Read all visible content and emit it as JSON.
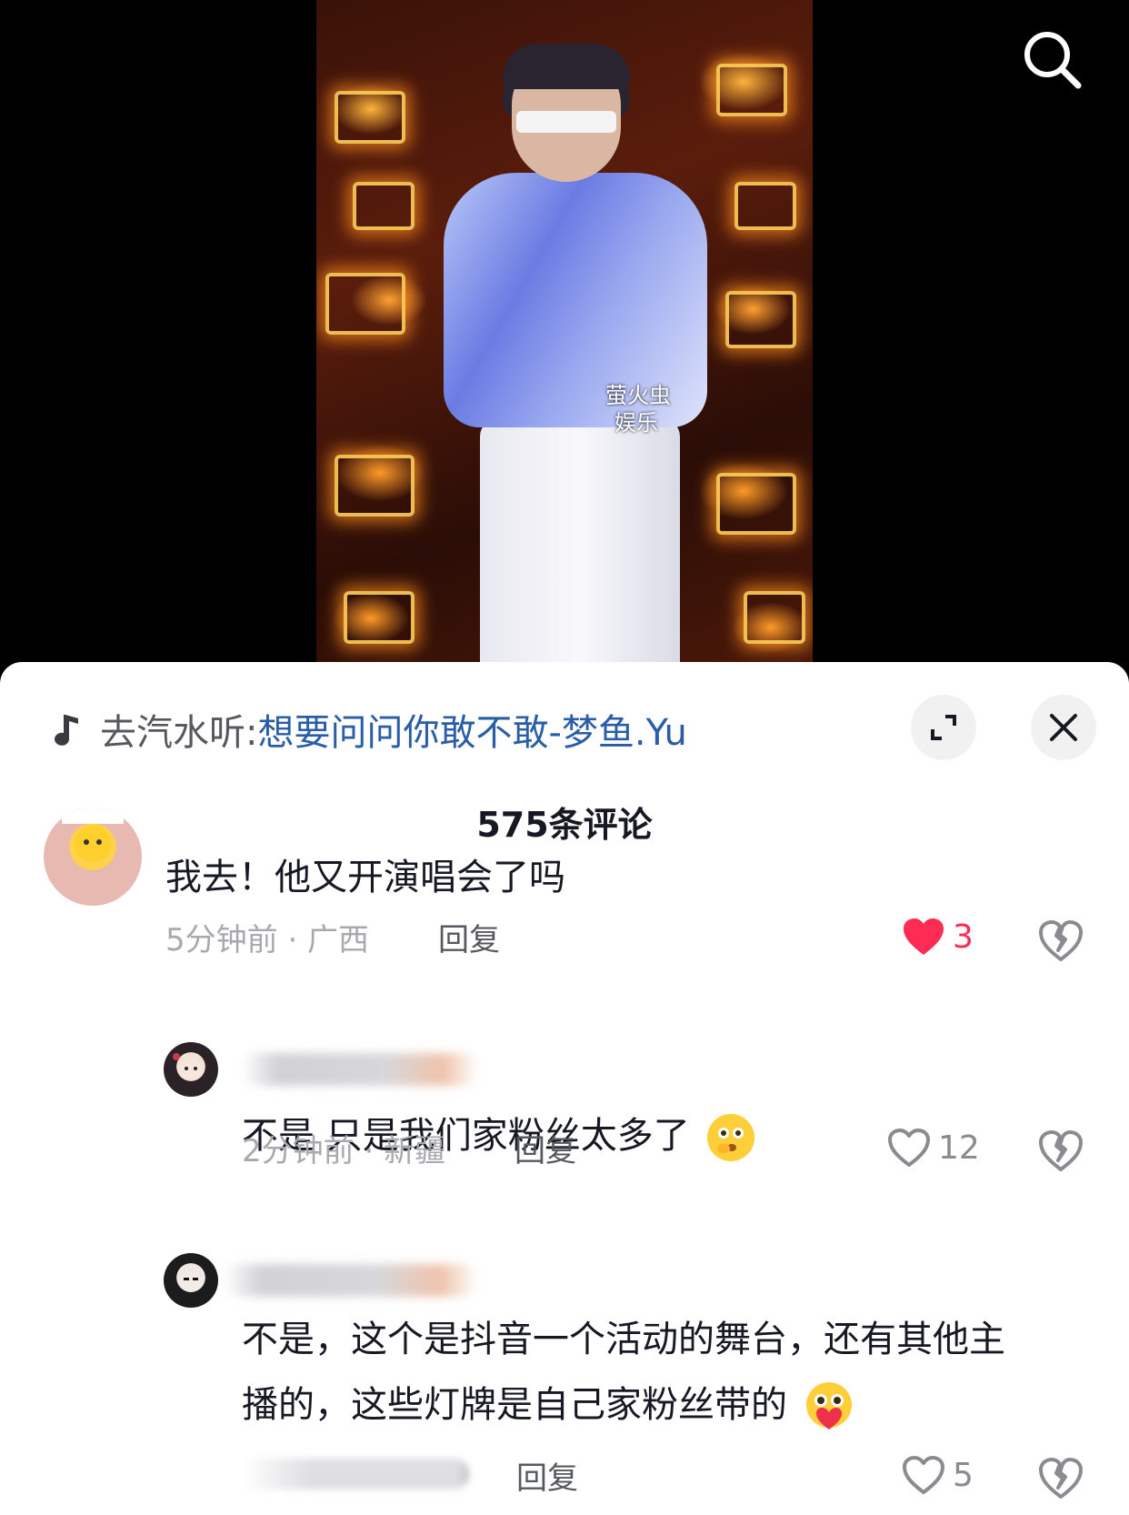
{
  "video": {
    "watermark_line1": "萤火虫",
    "watermark_line2": "娱乐"
  },
  "music": {
    "prefix": "去汽水听:",
    "song": "想要问问你敢不敢-梦鱼.Yu"
  },
  "comments_header": {
    "title": "575条评论"
  },
  "comments": [
    {
      "text": "我去！他又开演唱会了吗",
      "meta": "5分钟前 · 广西",
      "reply_label": "回复",
      "likes": "3",
      "liked": true
    },
    {
      "text": "不是 只是我们家粉丝太多了",
      "emoji": "thinking-face-emoji",
      "meta": "2分钟前 · 新疆",
      "reply_label": "回复",
      "likes": "12",
      "liked": false
    },
    {
      "text_line1": "不是，这个是抖音一个活动的舞台，还有其他主",
      "text_line2": "播的，这些灯牌是自己家粉丝带的",
      "emoji": "heart-hug-face-emoji",
      "reply_label": "回复",
      "likes": "5",
      "liked": false
    }
  ],
  "colors": {
    "accent_red": "#fe2c55",
    "link_blue": "#2a5da8",
    "meta_gray": "#a8a9ae"
  }
}
